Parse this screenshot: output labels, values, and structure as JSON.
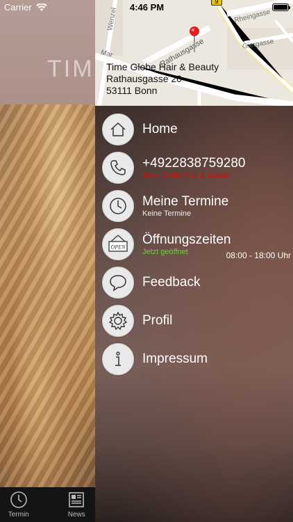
{
  "status": {
    "carrier": "Carrier",
    "time": "4:46 PM"
  },
  "background": {
    "brand_ghost": "TIME"
  },
  "tabs": [
    {
      "label": "Termin",
      "icon": "clock-icon"
    },
    {
      "label": "News",
      "icon": "newspaper-icon"
    }
  ],
  "map": {
    "streets": [
      "Rheingasse",
      "Giergasse",
      "Rathausgasse",
      "Wenzel",
      "Mar"
    ],
    "shield": "9",
    "address": {
      "name": "Time Globe Hair & Beauty",
      "street": "Rathausgasse 20",
      "city": "53111 Bonn"
    }
  },
  "menu": {
    "home": {
      "label": "Home",
      "icon": "home-icon"
    },
    "phone": {
      "label": "+4922838759280",
      "sub": "Time Globe Hair & Beauty",
      "icon": "phone-icon"
    },
    "appointments": {
      "label": "Meine Termine",
      "sub": "Keine Termine",
      "icon": "clock-icon"
    },
    "hours": {
      "label": "Öffnungszeiten",
      "sub": "Jetzt geöffnet",
      "hours": "08:00 - 18:00 Uhr",
      "icon": "open-sign-icon",
      "sign_text": "OPEN"
    },
    "feedback": {
      "label": "Feedback",
      "icon": "speech-bubble-icon"
    },
    "profile": {
      "label": "Profil",
      "icon": "gear-icon"
    },
    "imprint": {
      "label": "Impressum",
      "icon": "info-icon"
    }
  },
  "colors": {
    "phone_sub": "#d01010",
    "open_status": "#6fcf3a",
    "map_pin": "#e02020"
  }
}
